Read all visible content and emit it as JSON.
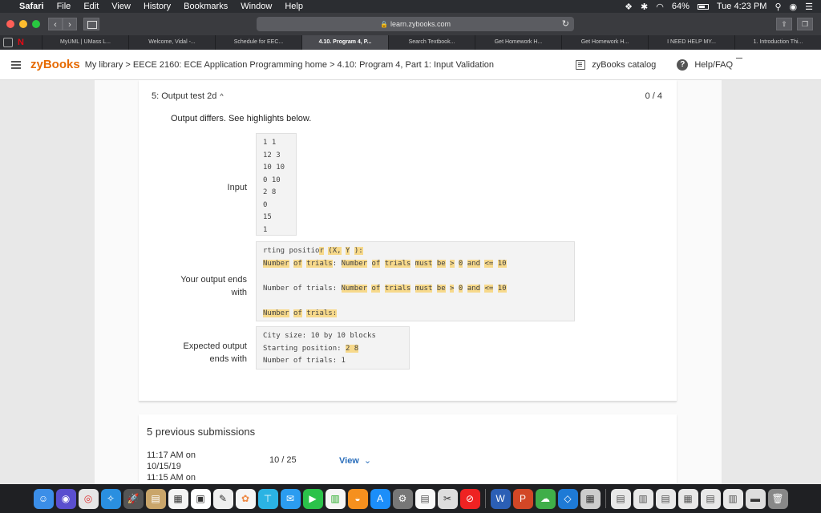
{
  "menubar": {
    "apple_icon": "",
    "app": "Safari",
    "items": [
      "File",
      "Edit",
      "View",
      "History",
      "Bookmarks",
      "Window",
      "Help"
    ],
    "battery": "64%",
    "clock": "Tue 4:23 PM"
  },
  "toolbar": {
    "url": "learn.zybooks.com",
    "back": "‹",
    "forward": "›"
  },
  "tabs": [
    {
      "label": "MyUML | UMass L...",
      "active": false
    },
    {
      "label": "Welcome, Vidal -...",
      "active": false
    },
    {
      "label": "Schedule for EEC...",
      "active": false
    },
    {
      "label": "4.10. Program 4, P...",
      "active": true
    },
    {
      "label": "Search Textbook...",
      "active": false
    },
    {
      "label": "Get Homework H...",
      "active": false
    },
    {
      "label": "Get Homework H...",
      "active": false
    },
    {
      "label": "I NEED HELP MY...",
      "active": false
    },
    {
      "label": "1. Introduction Thi...",
      "active": false
    }
  ],
  "header": {
    "logo": "zyBooks",
    "breadcrumb": "My library > EECE 2160: ECE Application Programming home > 4.10: Program 4, Part 1: Input Validation",
    "catalog": "zyBooks catalog",
    "help": "Help/FAQ",
    "help_glyph": "?"
  },
  "test": {
    "title": "5: Output test 2d",
    "chevron": "^",
    "score": "0 / 4",
    "message": "Output differs. See highlights below.",
    "input_label": "Input",
    "input_lines": [
      "1 1",
      "12 3",
      "10 10",
      "0 10",
      "2 8",
      "0",
      "15",
      "1"
    ],
    "your_output_label_1": "Your output ends",
    "your_output_label_2": "with",
    "expected_label_1": "Expected output",
    "expected_label_2": "ends with",
    "expected_lines": [
      "City size: 10 by 10 blocks",
      "Starting position: ",
      "Number of trials: 1"
    ],
    "expected_hl": "2 8"
  },
  "submissions": {
    "title": "5 previous submissions",
    "items": [
      {
        "when_1": "11:17 AM on",
        "when_2": "10/15/19",
        "score": "10 / 25",
        "view": "View",
        "chevron": "⌄"
      },
      {
        "when_1": "11:15 AM on"
      }
    ]
  },
  "colors": {
    "highlight": "#f7d98b",
    "zybooks_orange": "#e66a00",
    "link_blue": "#2a6ebb"
  }
}
